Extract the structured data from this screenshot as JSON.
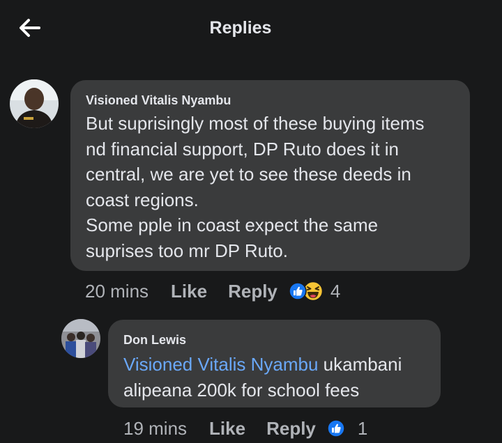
{
  "header": {
    "title": "Replies",
    "back_icon": "arrow-left-icon"
  },
  "colors": {
    "background": "#18191a",
    "bubble": "#3a3b3c",
    "mention": "#6aa8f8",
    "like_blue": "#1877f2",
    "haha_yellow": "#f7c435"
  },
  "comments": [
    {
      "author": "Visioned Vitalis Nyambu",
      "lines": [
        "But suprisingly most of these buying items",
        "nd financial support, DP Ruto does it in",
        "central, we are yet to see these deeds in",
        "coast regions.",
        "Some pple in coast expect the same",
        "suprises too mr DP Ruto."
      ],
      "time": "20 mins",
      "like_label": "Like",
      "reply_label": "Reply",
      "reactions": [
        "like-icon",
        "haha-icon"
      ],
      "reaction_count": "4"
    },
    {
      "author": "Don Lewis",
      "mention": "Visioned Vitalis Nyambu",
      "line1_rest": " ukambani",
      "line2": "alipeana 200k for school fees",
      "time": "19 mins",
      "like_label": "Like",
      "reply_label": "Reply",
      "reactions": [
        "like-icon"
      ],
      "reaction_count": "1"
    }
  ]
}
